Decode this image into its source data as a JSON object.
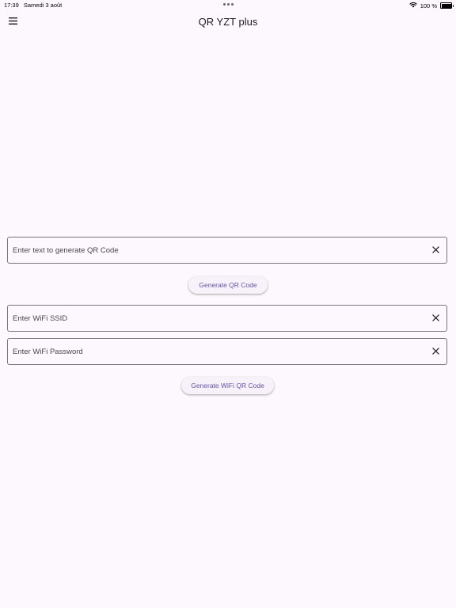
{
  "status_bar": {
    "time": "17:39",
    "date": "Samedi 3 août",
    "battery": "100 %",
    "battery_level": 1.0,
    "icons": [
      "wifi-icon",
      "battery-icon"
    ]
  },
  "app_bar": {
    "title": "QR YZT plus",
    "menu_icon": "menu-icon"
  },
  "text_qr": {
    "placeholder": "Enter text to generate QR Code",
    "value": "",
    "clear_icon": "close-icon"
  },
  "generate_qr_button": {
    "label": "Generate QR Code"
  },
  "wifi_ssid": {
    "placeholder": "Enter WiFi SSID",
    "value": "",
    "clear_icon": "close-icon"
  },
  "wifi_password": {
    "placeholder": "Enter WiFi Password",
    "value": "",
    "clear_icon": "close-icon"
  },
  "generate_wifi_button": {
    "label": "Generate WiFi QR Code"
  },
  "colors": {
    "background": "#fdf8fd",
    "accent": "#6750a4",
    "outline": "#79747e"
  }
}
